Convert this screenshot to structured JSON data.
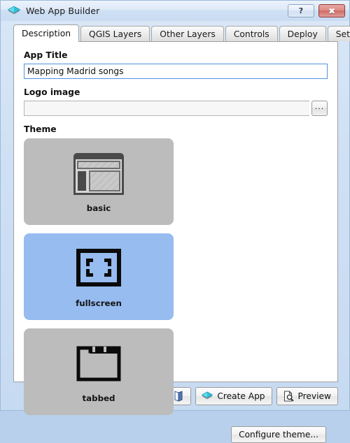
{
  "window": {
    "title": "Web App Builder",
    "icon": "cyan-diamond-icon",
    "help_label": "?",
    "close_label": "✖",
    "frame_color": "#c6daf1",
    "accent_color": "#4f93e0"
  },
  "tabs": [
    {
      "label": "Description",
      "active": true
    },
    {
      "label": "QGIS Layers",
      "active": false
    },
    {
      "label": "Other Layers",
      "active": false
    },
    {
      "label": "Controls",
      "active": false
    },
    {
      "label": "Deploy",
      "active": false
    },
    {
      "label": "Settings",
      "active": false
    }
  ],
  "form": {
    "app_title_label": "App Title",
    "app_title_value": "Mapping Madrid songs",
    "app_title_placeholder": "",
    "logo_label": "Logo image",
    "logo_value": "",
    "logo_placeholder": "",
    "logo_browse_label": "..."
  },
  "theme": {
    "section_label": "Theme",
    "selected": "fullscreen",
    "selected_color": "#96bcf0",
    "unselected_color": "#bcbcbc",
    "cards": [
      {
        "label": "basic",
        "icon": "layout-basic-icon",
        "selected": false
      },
      {
        "label": "fullscreen",
        "icon": "layout-fullscreen-icon",
        "selected": true
      },
      {
        "label": "tabbed",
        "icon": "layout-tabbed-icon",
        "selected": false
      }
    ],
    "configure_label": "Configure theme..."
  },
  "bottom_bar": {
    "buttons": [
      {
        "label": "",
        "icon": "open-folder-icon",
        "name": "open-project-button"
      },
      {
        "label": "",
        "icon": "save-disk-icon",
        "name": "save-project-button"
      },
      {
        "label": "",
        "icon": "open-book-icon",
        "name": "help-book-button"
      },
      {
        "label": "Create App",
        "icon": "cyan-diamond-icon",
        "name": "create-app-button"
      },
      {
        "label": "Preview",
        "icon": "page-magnifier-icon",
        "name": "preview-button"
      }
    ]
  }
}
